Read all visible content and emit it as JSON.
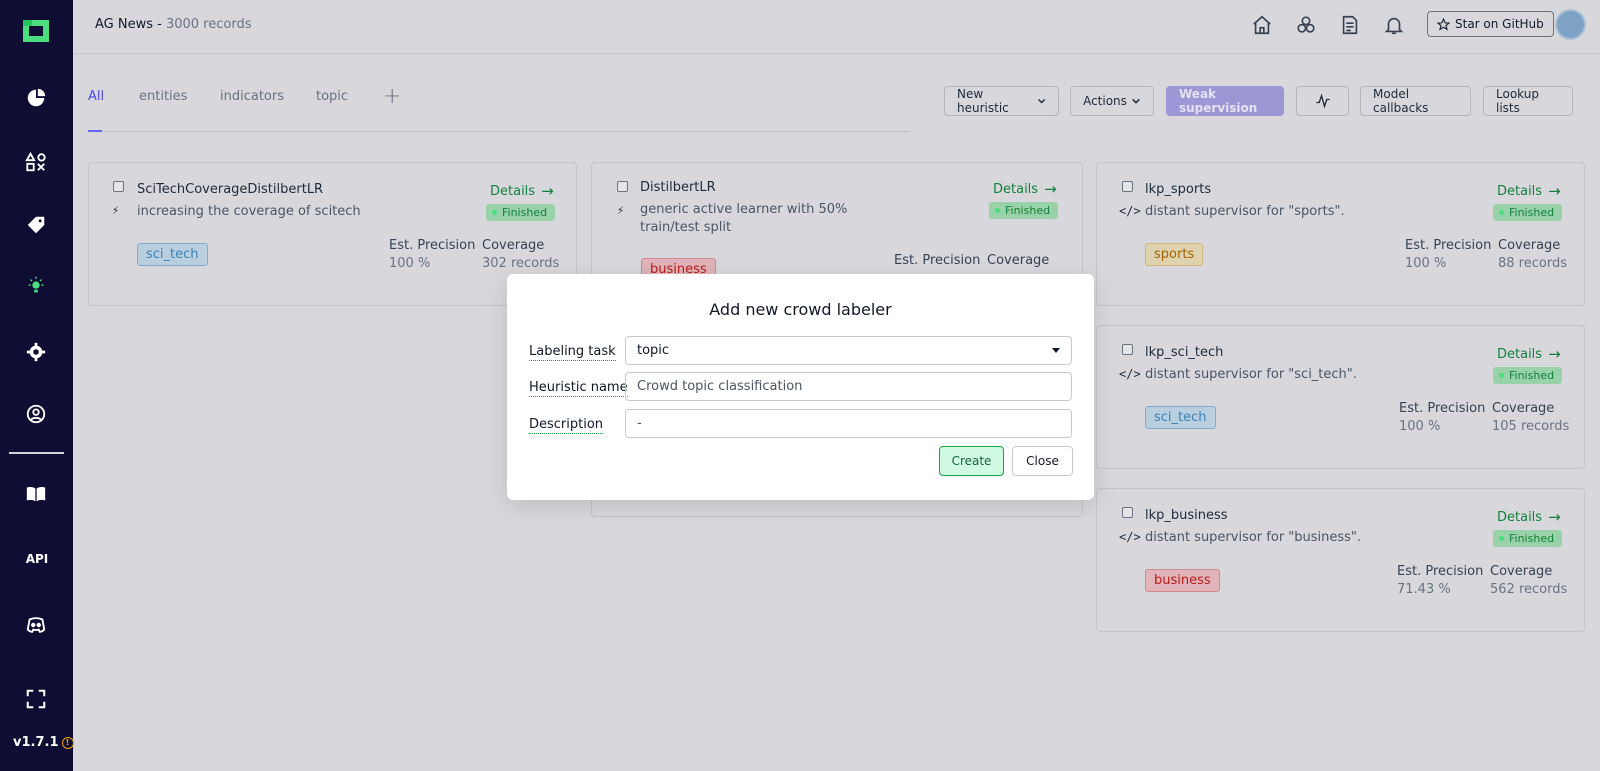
{
  "app": {
    "version": "v1.7.1"
  },
  "header": {
    "project_name": "AG News",
    "separator": " - ",
    "record_count": "3000 records",
    "star_label": "Star on GitHub"
  },
  "sidebar": {
    "api_label": "API"
  },
  "tabs": [
    {
      "label": "All",
      "active": true
    },
    {
      "label": "entities"
    },
    {
      "label": "indicators"
    },
    {
      "label": "topic"
    }
  ],
  "toolbar": {
    "new_heuristic": "New heuristic",
    "actions": "Actions",
    "weak_supervision": "Weak supervision",
    "model_callbacks": "Model callbacks",
    "lookup_lists": "Lookup lists"
  },
  "cards": [
    {
      "title": "SciTechCoverageDistilbertLR",
      "description": "increasing the coverage of scitech",
      "details": "Details",
      "status": "Finished",
      "label": "sci_tech",
      "precision_label": "Est. Precision",
      "precision": "100 %",
      "coverage_label": "Coverage",
      "coverage": "302 records"
    },
    {
      "title": "DistilbertLR",
      "description_line1": "generic active learner with 50%",
      "description_line2": "train/test split",
      "details": "Details",
      "status": "Finished",
      "label": "business",
      "precision_label": "Est. Precision",
      "coverage_label": "Coverage"
    },
    {
      "title": "lkp_sports",
      "description": "distant supervisor for \"sports\".",
      "details": "Details",
      "status": "Finished",
      "label": "sports",
      "precision_label": "Est. Precision",
      "precision": "100 %",
      "coverage_label": "Coverage",
      "coverage": "88 records"
    },
    {
      "title": "lkp_sci_tech",
      "description": "distant supervisor for \"sci_tech\".",
      "details": "Details",
      "status": "Finished",
      "label": "sci_tech",
      "precision_label": "Est. Precision",
      "precision": "100 %",
      "coverage_label": "Coverage",
      "coverage": "105 records"
    },
    {
      "title": "lkp_business",
      "description": "distant supervisor for \"business\".",
      "details": "Details",
      "status": "Finished",
      "label": "business",
      "precision_label": "Est. Precision",
      "precision": "71.43 %",
      "coverage_label": "Coverage",
      "coverage": "562 records"
    }
  ],
  "modal": {
    "title": "Add new crowd labeler",
    "labeling_task_label": "Labeling task",
    "labeling_task_value": "topic",
    "heuristic_name_label": "Heuristic name",
    "heuristic_name_value": "Crowd topic classification",
    "description_label": "Description",
    "description_value": "-",
    "create_label": "Create",
    "close_label": "Close"
  },
  "colors": {
    "sidebar_bg": "#0f0d33",
    "accent": "#6366f1",
    "logo": "#4ade80",
    "success": "#15803d"
  }
}
